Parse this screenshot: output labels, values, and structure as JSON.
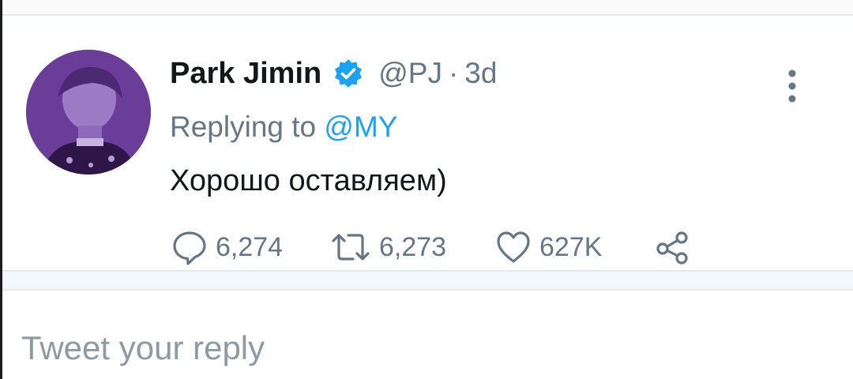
{
  "tweet": {
    "display_name": "Park Jimin",
    "handle": "@PJ",
    "separator": "·",
    "time": "3d",
    "replying_prefix": "Replying to",
    "replying_to": "@MY",
    "text": "Хорошо оставляем)",
    "avatar_icon": "profile-photo-purple",
    "verified_icon": "verified-badge-icon",
    "more_icon": "vertical-ellipsis-icon"
  },
  "actions": {
    "reply": {
      "icon": "comment-icon",
      "count": "6,274"
    },
    "retweet": {
      "icon": "retweet-icon",
      "count": "6,273"
    },
    "like": {
      "icon": "heart-icon",
      "count": "627K"
    },
    "share": {
      "icon": "share-icon"
    }
  },
  "reply_box": {
    "placeholder": "Tweet your reply"
  },
  "colors": {
    "text_primary": "#14171a",
    "text_secondary": "#657786",
    "accent": "#1da1f2",
    "divider": "#e6e9eb"
  }
}
